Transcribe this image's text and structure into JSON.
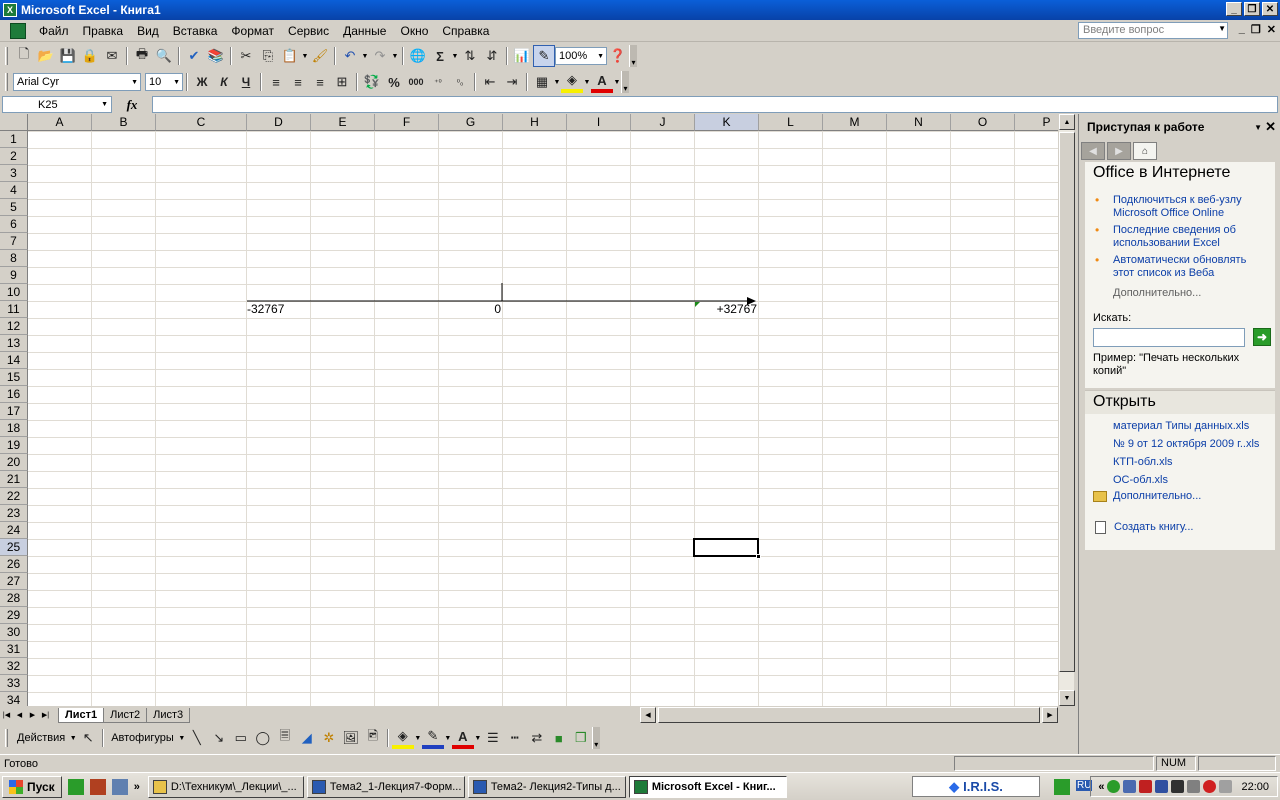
{
  "window": {
    "title": "Microsoft Excel - Книга1",
    "app_icon": "excel-icon"
  },
  "menu": {
    "items": [
      "Файл",
      "Правка",
      "Вид",
      "Вставка",
      "Формат",
      "Сервис",
      "Данные",
      "Окно",
      "Справка"
    ],
    "ask_placeholder": "Введите вопрос"
  },
  "toolbar_standard": {
    "zoom": "100%"
  },
  "toolbar_format": {
    "font": "Arial Cyr",
    "size": "10",
    "bold": "Ж",
    "italic": "К",
    "underline": "Ч"
  },
  "formula_bar": {
    "name_box": "K25",
    "fx": "fx",
    "value": ""
  },
  "grid": {
    "columns": [
      "A",
      "B",
      "C",
      "D",
      "E",
      "F",
      "G",
      "H",
      "I",
      "J",
      "K",
      "L",
      "M",
      "N",
      "O",
      "P"
    ],
    "rows": [
      "1",
      "2",
      "3",
      "4",
      "5",
      "6",
      "7",
      "8",
      "9",
      "10",
      "11",
      "12",
      "13",
      "14",
      "15",
      "16",
      "17",
      "18",
      "19",
      "20",
      "21",
      "22",
      "23",
      "24",
      "25",
      "26",
      "27",
      "28",
      "29",
      "30",
      "31",
      "32",
      "33",
      "34"
    ],
    "active_cell": "K25",
    "cells": {
      "D10": "-32767",
      "G10": "0",
      "K10": "+32767"
    }
  },
  "sheets": {
    "tabs": [
      "Лист1",
      "Лист2",
      "Лист3"
    ],
    "active": "Лист1"
  },
  "drawing_toolbar": {
    "actions": "Действия",
    "autoshapes": "Автофигуры"
  },
  "status": {
    "text": "Готово",
    "num": "NUM"
  },
  "taskpane": {
    "title": "Приступая к работе",
    "online_title": "Office в Интернете",
    "online_links": [
      "Подключиться к веб-узлу Microsoft Office Online",
      "Последние сведения об использовании Excel",
      "Автоматически обновлять этот список из Веба"
    ],
    "more": "Дополнительно...",
    "search_label": "Искать:",
    "example": "Пример:  \"Печать нескольких копий\"",
    "open_title": "Открыть",
    "open_files": [
      "материал Типы данных.xls",
      "№ 9 от 12 октября 2009 г..xls",
      "КТП-обл.xls",
      "ОС-обл.xls"
    ],
    "open_more": "Дополнительно...",
    "create": "Создать книгу..."
  },
  "taskbar": {
    "start": "Пуск",
    "items": [
      "D:\\Техникум\\_Лекции\\_...",
      "Тема2_1-Лекция7-Форм...",
      "Тема2- Лекция2-Типы д...",
      "Microsoft Excel - Книг..."
    ],
    "iris": "I.R.I.S.",
    "lang": "RU",
    "clock": "22:00"
  }
}
